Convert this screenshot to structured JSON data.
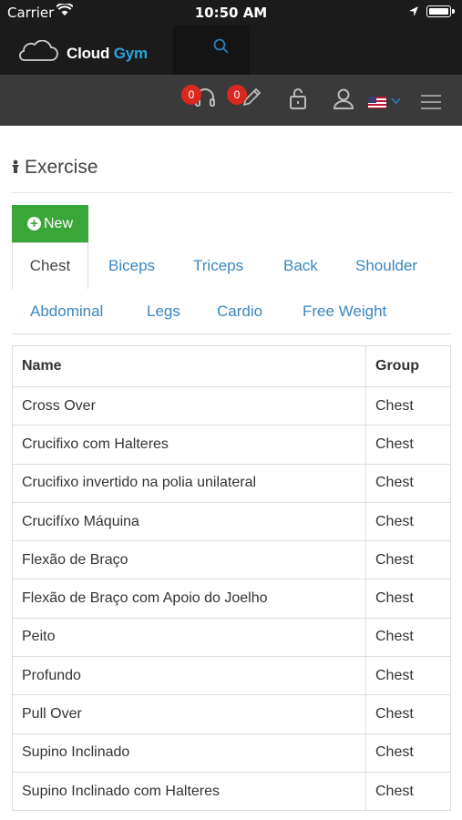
{
  "status_bar": {
    "carrier": "Carrier",
    "time": "10:50 AM",
    "icons": [
      "wifi-icon",
      "location-arrow-icon",
      "battery-icon"
    ]
  },
  "brand": {
    "name_part1": "Cloud",
    "name_part2": "Gym",
    "accent_color": "#2aa4dc",
    "logo_icon": "cloud-icon",
    "search_icon": "search-icon"
  },
  "toolbar": {
    "support_badge": "0",
    "edit_badge": "0",
    "icons": [
      "headset-icon",
      "pencil-icon",
      "lock-icon",
      "user-icon",
      "us-flag-icon",
      "chevron-down-icon",
      "hamburger-menu-icon"
    ]
  },
  "page": {
    "title": "Exercise",
    "new_button": "New"
  },
  "tabs": [
    {
      "label": "Chest",
      "active": true
    },
    {
      "label": "Biceps",
      "active": false
    },
    {
      "label": "Triceps",
      "active": false
    },
    {
      "label": "Back",
      "active": false
    },
    {
      "label": "Shoulder",
      "active": false
    },
    {
      "label": "Abdominal",
      "active": false
    },
    {
      "label": "Legs",
      "active": false
    },
    {
      "label": "Cardio",
      "active": false
    },
    {
      "label": "Free Weight",
      "active": false
    }
  ],
  "table": {
    "columns": [
      "Name",
      "Group"
    ],
    "rows": [
      [
        "Cross Over",
        "Chest"
      ],
      [
        "Crucifixo com Halteres",
        "Chest"
      ],
      [
        "Crucifixo invertido na polia unilateral",
        "Chest"
      ],
      [
        "Crucifíxo Máquina",
        "Chest"
      ],
      [
        "Flexão de Braço",
        "Chest"
      ],
      [
        "Flexão de Braço com Apoio do Joelho",
        "Chest"
      ],
      [
        "Peito",
        "Chest"
      ],
      [
        "Profundo",
        "Chest"
      ],
      [
        "Pull Over",
        "Chest"
      ],
      [
        "Supino Inclinado",
        "Chest"
      ],
      [
        "Supino Inclinado com Halteres",
        "Chest"
      ]
    ]
  },
  "colors": {
    "header_bg": "#1b1b1b",
    "toolbar_bg": "#3a3a3a",
    "new_button": "#3aa63a",
    "tab_link": "#3a87c0",
    "badge": "#d9281f"
  }
}
